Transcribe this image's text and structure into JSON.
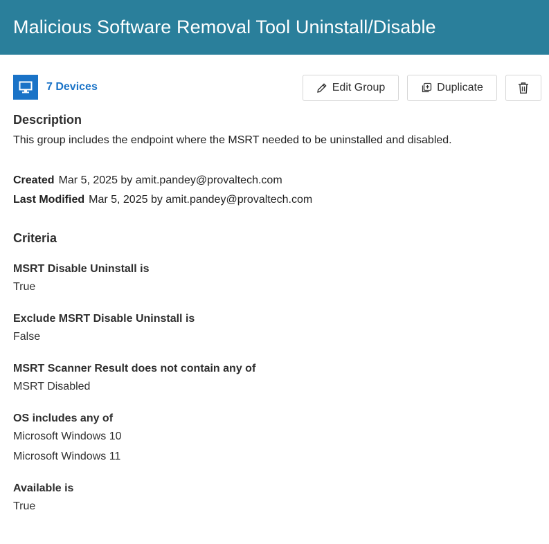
{
  "header": {
    "title": "Malicious Software Removal Tool Uninstall/Disable"
  },
  "toolbar": {
    "devices_label": "7 Devices",
    "edit_label": "Edit Group",
    "duplicate_label": "Duplicate",
    "delete_icon": "trash-icon"
  },
  "description": {
    "title": "Description",
    "text": "This group includes the endpoint where the MSRT needed to be uninstalled and disabled."
  },
  "meta": {
    "created_label": "Created",
    "created_value": "Mar 5, 2025 by amit.pandey@provaltech.com",
    "modified_label": "Last Modified",
    "modified_value": "Mar 5, 2025 by amit.pandey@provaltech.com"
  },
  "criteria": {
    "title": "Criteria",
    "items": [
      {
        "label": "MSRT Disable Uninstall is",
        "values": [
          "True"
        ]
      },
      {
        "label": "Exclude MSRT Disable Uninstall is",
        "values": [
          "False"
        ]
      },
      {
        "label": "MSRT Scanner Result does not contain any of",
        "values": [
          "MSRT Disabled"
        ]
      },
      {
        "label": "OS includes any of",
        "values": [
          "Microsoft Windows 10",
          "Microsoft Windows 11"
        ]
      },
      {
        "label": "Available is",
        "values": [
          "True"
        ]
      }
    ]
  },
  "colors": {
    "header_bg": "#2a7f9b",
    "accent": "#1a73c7"
  }
}
